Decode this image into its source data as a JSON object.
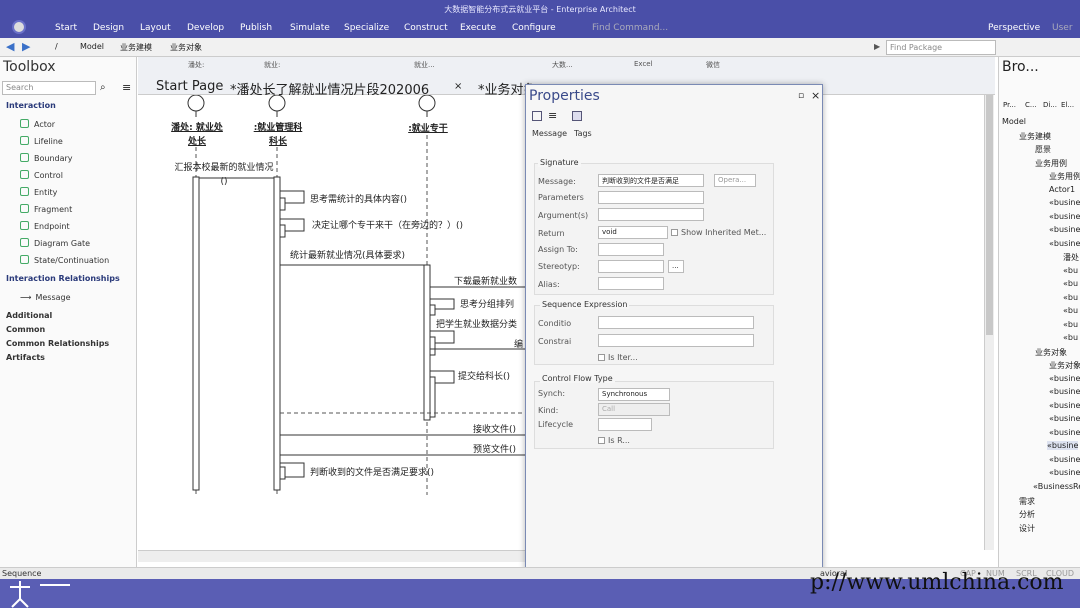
{
  "window": {
    "title": "大数据智能分布式云就业平台 - Enterprise Architect"
  },
  "menu": {
    "items": [
      "Start",
      "Design",
      "Layout",
      "Develop",
      "Publish",
      "Simulate",
      "Specialize",
      "Construct",
      "Execute",
      "Configure"
    ],
    "find_command": "Find Command...",
    "perspective": "Perspective",
    "user": "User"
  },
  "address": {
    "crumbs": [
      "/",
      "Model",
      "业务建模",
      "业务对象"
    ],
    "find_package": "Find Package"
  },
  "toolbox": {
    "title": "Toolbox",
    "search_placeholder": "Search",
    "interaction_header": "Interaction",
    "interaction_items": [
      "Actor",
      "Lifeline",
      "Boundary",
      "Control",
      "Entity",
      "Fragment",
      "Endpoint",
      "Diagram Gate",
      "State/Continuation"
    ],
    "relationships_header": "Interaction Relationships",
    "relationship_items": [
      "Message"
    ],
    "collapsed_sections": [
      "Additional",
      "Common",
      "Common Relationships",
      "Artifacts"
    ]
  },
  "diagram_toolbar": {
    "swimlanes": [
      "潘处:",
      "就业:",
      "就业...",
      "大数...",
      "Excel",
      "微信"
    ]
  },
  "tabs": [
    {
      "label": "Start Page"
    },
    {
      "label": "*潘处长了解就业情况片段202006"
    },
    {
      "label": "*业务对象"
    }
  ],
  "diagram": {
    "lifelines": [
      "潘处: 就业处处长",
      ":就业管理科科长",
      ":就业专干"
    ],
    "messages": [
      "汇报本校最新的就业情况()",
      "思考需统计的具体内容()",
      "决定让哪个专干来干（在旁边的？）()",
      "统计最新就业情况(具体要求)",
      "下载最新就业数",
      "思考分组排列",
      "把学生就业数据分类",
      "编",
      "提交给科长()",
      "接收文件()",
      "预览文件()",
      "判断收到的文件是否满足要求()"
    ]
  },
  "properties": {
    "title": "Properties",
    "tabs": [
      "Message",
      "Tags"
    ],
    "signature": {
      "group": "Signature",
      "message_label": "Message:",
      "message_value": "判断收到的文件是否满足",
      "opera_button": "Opera...",
      "parameters_label": "Parameters",
      "arguments_label": "Argument(s)",
      "return_label": "Return",
      "return_value": "void",
      "show_inherited": "Show Inherited Met...",
      "assign_to_label": "Assign To:",
      "stereotype_label": "Stereotyp:",
      "stereo_button": "...",
      "alias_label": "Alias:"
    },
    "sequence_expression": {
      "group": "Sequence Expression",
      "condition_label": "Conditio",
      "constraint_label": "Constrai",
      "is_iter": "Is Iter..."
    },
    "control_flow": {
      "group": "Control Flow Type",
      "synch_label": "Synch:",
      "synch_value": "Synchronous",
      "kind_label": "Kind:",
      "kind_value": "Call",
      "lifecycle_label": "Lifecycle",
      "is_r": "Is R..."
    }
  },
  "browser": {
    "title": "Bro...",
    "tabs": [
      "Pr...",
      "C...",
      "Di...",
      "El..."
    ],
    "tree": [
      "Model",
      "业务建模",
      "愿景",
      "业务用例",
      "业务用例",
      "Actor1",
      "«busine",
      "«busine",
      "«busine",
      "«busine",
      "潘处",
      "«bu",
      "«bu",
      "«bu",
      "«bu",
      "«bu",
      "«bu",
      "业务对象",
      "业务对象",
      "«busine",
      "«busine",
      "«busine",
      "«busine",
      "«busine",
      "«busine",
      "«busine",
      "«busine",
      "«BusinessRe",
      "需求",
      "分析",
      "设计"
    ]
  },
  "status": {
    "left": "Sequence",
    "mode": "avioral",
    "indicators": [
      "CAP",
      "NUM",
      "SCRL",
      "CLOUD"
    ]
  },
  "watermark": "p://www.umlchina.com",
  "colors": {
    "ribbon": "#4a4fa8",
    "accent": "#3a4a8a",
    "window_border": "#7a8ab4"
  }
}
